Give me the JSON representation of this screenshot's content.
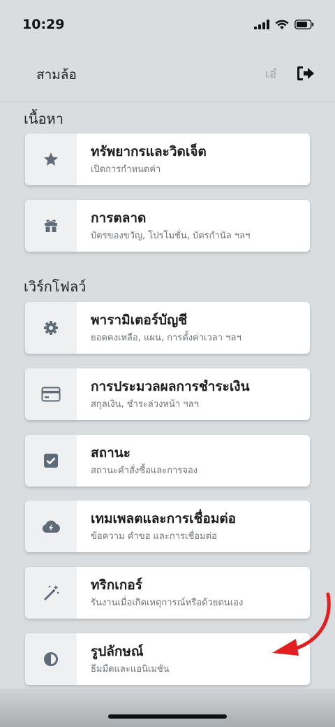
{
  "status_bar": {
    "time": "10:29"
  },
  "header": {
    "title": "สามล้อ",
    "user_initials": "เอ๋"
  },
  "sections": [
    {
      "title": "เนื้อหา",
      "items": [
        {
          "title": "ทรัพยากรและวิดเจ็ต",
          "subtitle": "เปิดการกำหนดค่า",
          "icon": "star-icon"
        },
        {
          "title": "การตลาด",
          "subtitle": "บัตรของขวัญ, โปรโมชั่น, บัตรกำนัล ฯลฯ",
          "icon": "gift-icon"
        }
      ]
    },
    {
      "title": "เวิร์กโฟลว์",
      "items": [
        {
          "title": "พารามิเตอร์บัญชี",
          "subtitle": "ยอดคงเหลือ, แผน, การตั้งค่าเวลา ฯลฯ",
          "icon": "gear-icon"
        },
        {
          "title": "การประมวลผลการชำระเงิน",
          "subtitle": "สกุลเงิน, ชำระล่วงหน้า ฯลฯ",
          "icon": "credit-card-icon"
        },
        {
          "title": "สถานะ",
          "subtitle": "สถานะคำสั่งซื้อและการจอง",
          "icon": "checkbox-icon"
        },
        {
          "title": "เทมเพลตและการเชื่อมต่อ",
          "subtitle": "ข้อความ คำขอ และการเชื่อมต่อ",
          "icon": "cloud-icon"
        },
        {
          "title": "ทริกเกอร์",
          "subtitle": "รันงานเมื่อเกิดเหตุการณ์หรือด้วยตนเอง",
          "icon": "magic-wand-icon"
        },
        {
          "title": "รูปลักษณ์",
          "subtitle": "ธีมมืดและแอนิเมชัน",
          "icon": "contrast-icon"
        }
      ]
    }
  ],
  "colors": {
    "background": "#d9dde0",
    "icon": "#5f6b78",
    "arrow": "#e02020"
  }
}
